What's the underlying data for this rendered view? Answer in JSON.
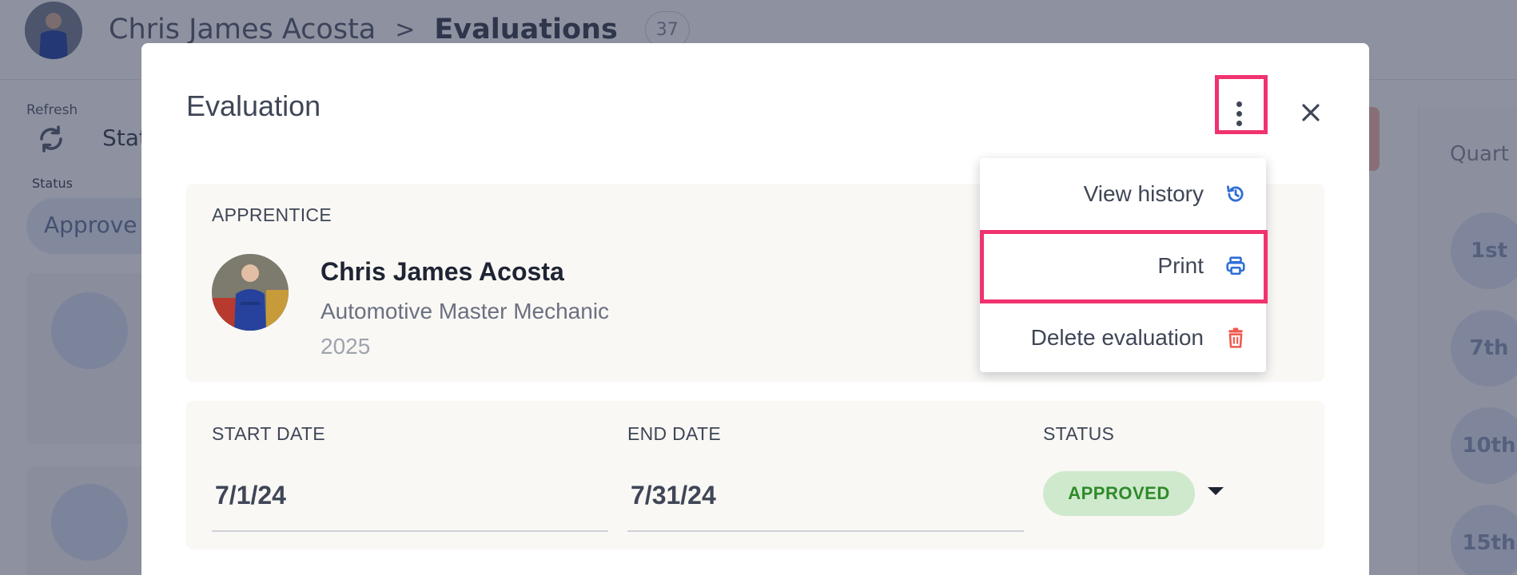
{
  "background": {
    "header": {
      "person_name": "Chris James Acosta",
      "separator": ">",
      "section": "Evaluations",
      "count": "37"
    },
    "refresh_label": "Refresh",
    "status_partial": "Stat",
    "status_label": "Status",
    "status_value_partial": "Approve",
    "right_panel": {
      "heading_partial": "Quart",
      "circles": [
        "1st",
        "7th",
        "10th",
        "15th"
      ]
    }
  },
  "modal": {
    "title": "Evaluation",
    "apprentice": {
      "label": "APPRENTICE",
      "name": "Chris James Acosta",
      "program": "Automotive Master Mechanic",
      "year": "2025"
    },
    "dates": {
      "start_label": "START DATE",
      "start_value": "7/1/24",
      "end_label": "END DATE",
      "end_value": "7/31/24",
      "status_label": "STATUS",
      "status_value": "APPROVED"
    }
  },
  "menu": {
    "items": [
      {
        "label": "View history",
        "icon": "history-icon"
      },
      {
        "label": "Print",
        "icon": "printer-icon"
      },
      {
        "label": "Delete evaluation",
        "icon": "trash-icon"
      }
    ]
  },
  "colors": {
    "highlight": "#f0336f",
    "status_bg": "#cfe9cd",
    "status_text": "#2f8a2a",
    "icon_blue": "#2f6fd6",
    "icon_red": "#f05a4f"
  }
}
